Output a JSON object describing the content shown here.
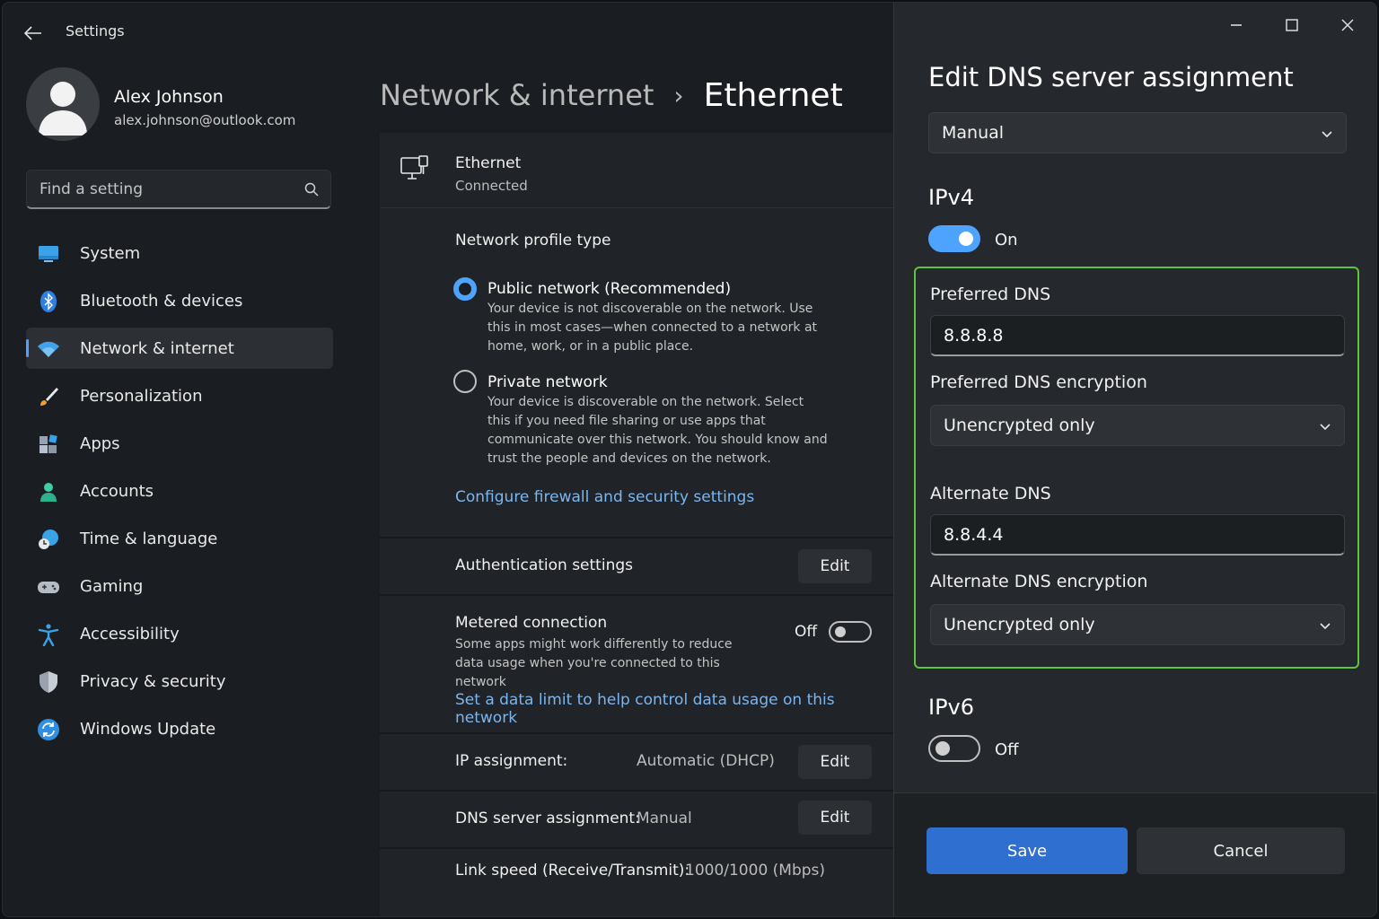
{
  "app": {
    "title": "Settings"
  },
  "user": {
    "name": "Alex Johnson",
    "email": "alex.johnson@outlook.com"
  },
  "search": {
    "placeholder": "Find a setting"
  },
  "sidebar": {
    "items": [
      {
        "label": "System",
        "icon": "monitor-icon"
      },
      {
        "label": "Bluetooth & devices",
        "icon": "bluetooth-icon"
      },
      {
        "label": "Network & internet",
        "icon": "wifi-icon",
        "active": true
      },
      {
        "label": "Personalization",
        "icon": "brush-icon"
      },
      {
        "label": "Apps",
        "icon": "apps-icon"
      },
      {
        "label": "Accounts",
        "icon": "person-icon"
      },
      {
        "label": "Time & language",
        "icon": "globe-clock-icon"
      },
      {
        "label": "Gaming",
        "icon": "gamepad-icon"
      },
      {
        "label": "Accessibility",
        "icon": "accessibility-icon"
      },
      {
        "label": "Privacy & security",
        "icon": "shield-icon"
      },
      {
        "label": "Windows Update",
        "icon": "refresh-icon"
      }
    ]
  },
  "breadcrumb": {
    "parent": "Network & internet",
    "separator": "›",
    "current": "Ethernet"
  },
  "ethernet": {
    "title": "Ethernet",
    "status": "Connected"
  },
  "profile": {
    "title": "Network profile type",
    "public_title": "Public network (Recommended)",
    "public_desc": "Your device is not discoverable on the network. Use this in most cases—when connected to a network at home, work, or in a public place.",
    "private_title": "Private network",
    "private_desc": "Your device is discoverable on the network. Select this if you need file sharing or use apps that communicate over this network. You should know and trust the people and devices on the network.",
    "firewall_link": "Configure firewall and security settings"
  },
  "auth": {
    "label": "Authentication settings",
    "button": "Edit"
  },
  "metered": {
    "label": "Metered connection",
    "desc": "Some apps might work differently to reduce data usage when you're connected to this network",
    "state": "Off",
    "link": "Set a data limit to help control data usage on this network"
  },
  "ip": {
    "label": "IP assignment:",
    "value": "Automatic (DHCP)",
    "button": "Edit"
  },
  "dns": {
    "label": "DNS server assignment:",
    "value": "Manual",
    "button": "Edit"
  },
  "link_speed": {
    "label": "Link speed (Receive/Transmit):",
    "value": "1000/1000 (Mbps)"
  },
  "dialog": {
    "title": "Edit DNS server assignment",
    "mode": "Manual",
    "ipv4": {
      "heading": "IPv4",
      "state": "On"
    },
    "preferred_dns_label": "Preferred DNS",
    "preferred_dns_value": "8.8.8.8",
    "preferred_enc_label": "Preferred DNS encryption",
    "preferred_enc_value": "Unencrypted only",
    "alternate_dns_label": "Alternate DNS",
    "alternate_dns_value": "8.8.4.4",
    "alternate_enc_label": "Alternate DNS encryption",
    "alternate_enc_value": "Unencrypted only",
    "ipv6": {
      "heading": "IPv6",
      "state": "Off"
    },
    "save": "Save",
    "cancel": "Cancel"
  },
  "colors": {
    "accent": "#4ea3ff",
    "highlight": "#5ec43a",
    "save": "#2f6fd0"
  }
}
